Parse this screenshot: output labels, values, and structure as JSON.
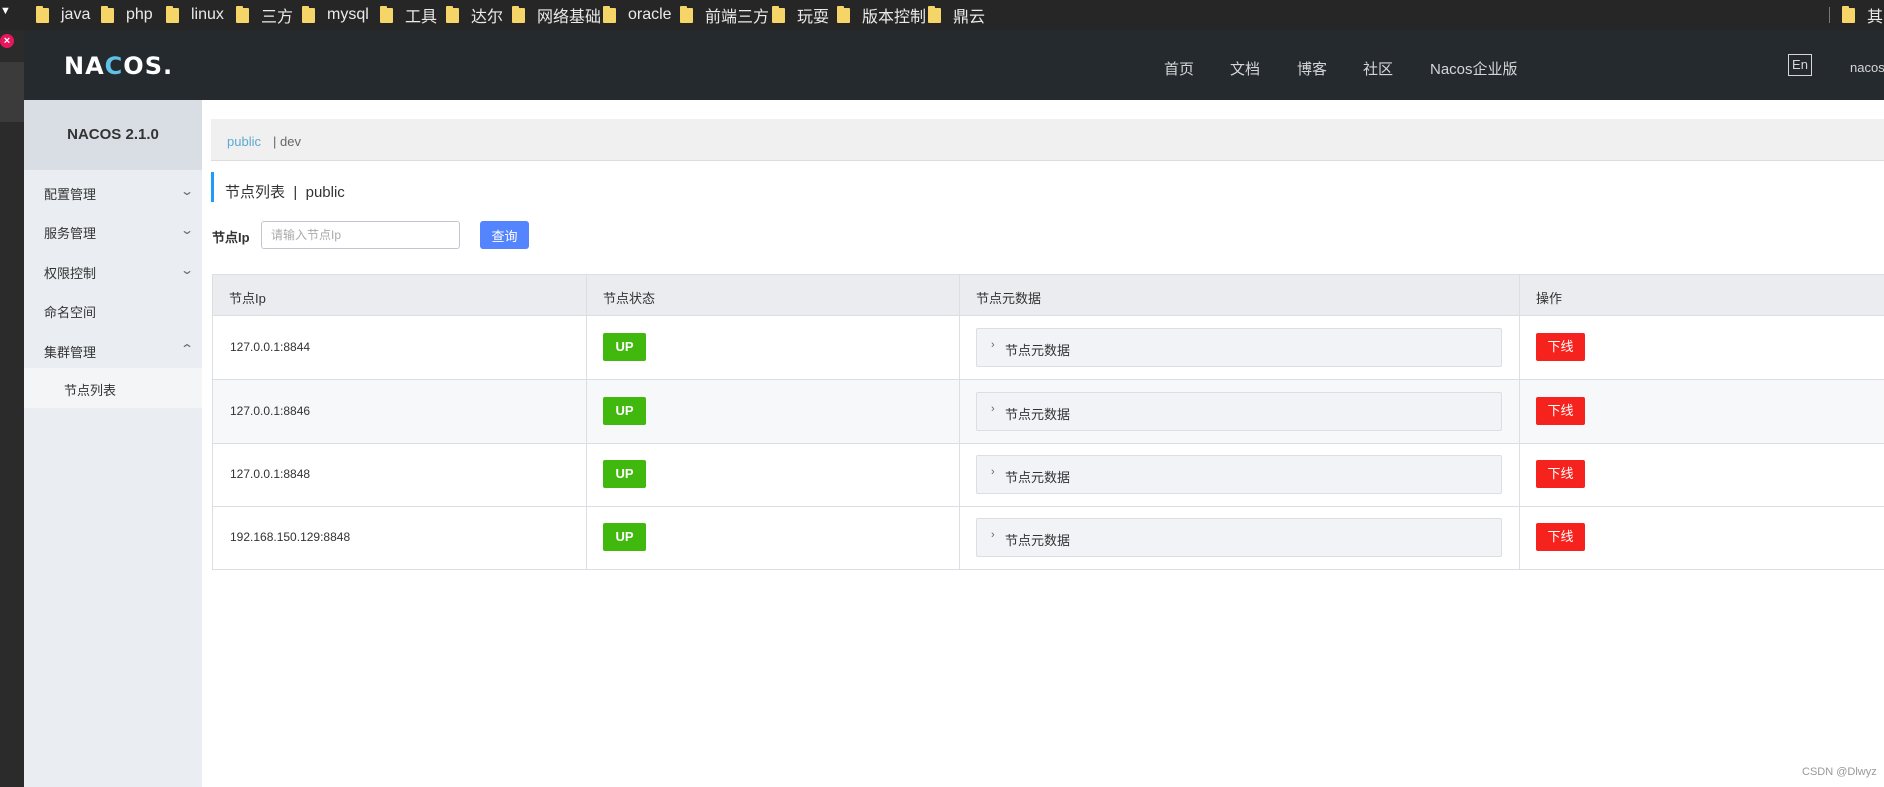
{
  "bookmarks": {
    "items": [
      {
        "label": "java"
      },
      {
        "label": "php"
      },
      {
        "label": "linux"
      },
      {
        "label": "三方"
      },
      {
        "label": "mysql"
      },
      {
        "label": "工具"
      },
      {
        "label": "达尔"
      },
      {
        "label": "网络基础"
      },
      {
        "label": "oracle"
      },
      {
        "label": "前端三方"
      },
      {
        "label": "玩耍"
      },
      {
        "label": "版本控制"
      },
      {
        "label": "鼎云"
      }
    ],
    "overflow_label": "其"
  },
  "header": {
    "logo_text": "NACOS.",
    "nav": [
      {
        "label": "首页"
      },
      {
        "label": "文档"
      },
      {
        "label": "博客"
      },
      {
        "label": "社区"
      },
      {
        "label": "Nacos企业版"
      }
    ],
    "lang_button": "En",
    "user": "nacos"
  },
  "sidebar": {
    "version": "NACOS 2.1.0",
    "items": [
      {
        "label": "配置管理",
        "expandable": true,
        "expanded": false
      },
      {
        "label": "服务管理",
        "expandable": true,
        "expanded": false
      },
      {
        "label": "权限控制",
        "expandable": true,
        "expanded": false
      },
      {
        "label": "命名空间",
        "expandable": false
      },
      {
        "label": "集群管理",
        "expandable": true,
        "expanded": true
      }
    ],
    "subitems": [
      {
        "label": "节点列表"
      }
    ]
  },
  "namespace_tabs": {
    "active": "public",
    "separator": "|",
    "other": "dev"
  },
  "page": {
    "title": "节点列表",
    "title_sep": "|",
    "namespace": "public"
  },
  "search": {
    "label": "节点Ip",
    "placeholder": "请输入节点Ip",
    "value": "",
    "button": "查询"
  },
  "table": {
    "columns": [
      "节点Ip",
      "节点状态",
      "节点元数据",
      "操作"
    ],
    "rows": [
      {
        "ip": "127.0.0.1:8844",
        "status": "UP",
        "metadata_label": "节点元数据",
        "action": "下线"
      },
      {
        "ip": "127.0.0.1:8846",
        "status": "UP",
        "metadata_label": "节点元数据",
        "action": "下线"
      },
      {
        "ip": "127.0.0.1:8848",
        "status": "UP",
        "metadata_label": "节点元数据",
        "action": "下线"
      },
      {
        "ip": "192.168.150.129:8848",
        "status": "UP",
        "metadata_label": "节点元数据",
        "action": "下线"
      }
    ]
  },
  "watermark": "CSDN @Dlwyz",
  "colors": {
    "topnav_bg": "#252a2f",
    "status_up": "#40b80d",
    "offline": "#f5221d",
    "primary_btn": "#5584ff",
    "tab_active": "#5fa8d3"
  }
}
